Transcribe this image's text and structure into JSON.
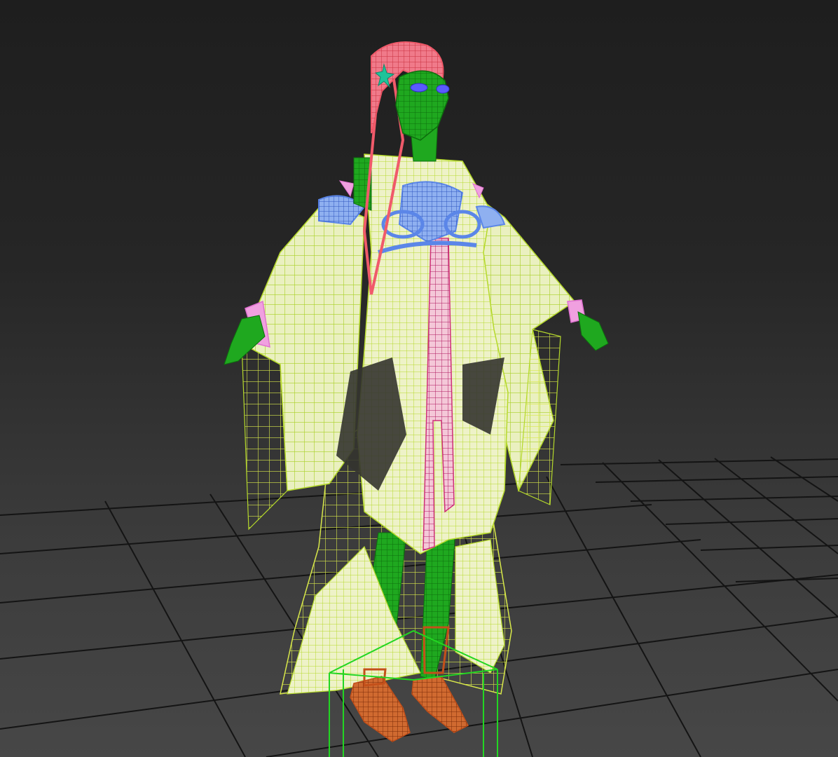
{
  "viewport": {
    "view": "perspective",
    "display_mode": "shaded-with-wireframe",
    "background_top": "#1e1e1e",
    "background_bottom": "#474747",
    "grid_color": "#141414",
    "selection_color": "#22d622"
  },
  "scene": {
    "objects": [
      {
        "name": "hair",
        "wire_color": "#f05a6a"
      },
      {
        "name": "head",
        "wire_color": "#1fa81f"
      },
      {
        "name": "eyes",
        "wire_color": "#5a5aff"
      },
      {
        "name": "hair-ornament",
        "wire_color": "#1fc39a"
      },
      {
        "name": "body-skin",
        "wire_color": "#1fa81f"
      },
      {
        "name": "robe",
        "wire_color": "#b5d92b",
        "fill_color": "#eef2c8"
      },
      {
        "name": "robe-sleeves",
        "wire_color": "#b5d92b",
        "fill_color": "#eef2c8"
      },
      {
        "name": "outer-skirt-wire",
        "wire_color": "#d8e84a"
      },
      {
        "name": "sash-knot",
        "wire_color": "#5b86e8"
      },
      {
        "name": "sash-ribbon",
        "wire_color": "#d0307a",
        "fill_color": "#f4c8d8"
      },
      {
        "name": "cuffs",
        "wire_color": "#e070d0"
      },
      {
        "name": "shoes",
        "wire_color": "#c4501a"
      },
      {
        "name": "selection-bounding-box",
        "wire_color": "#22d622"
      }
    ]
  }
}
